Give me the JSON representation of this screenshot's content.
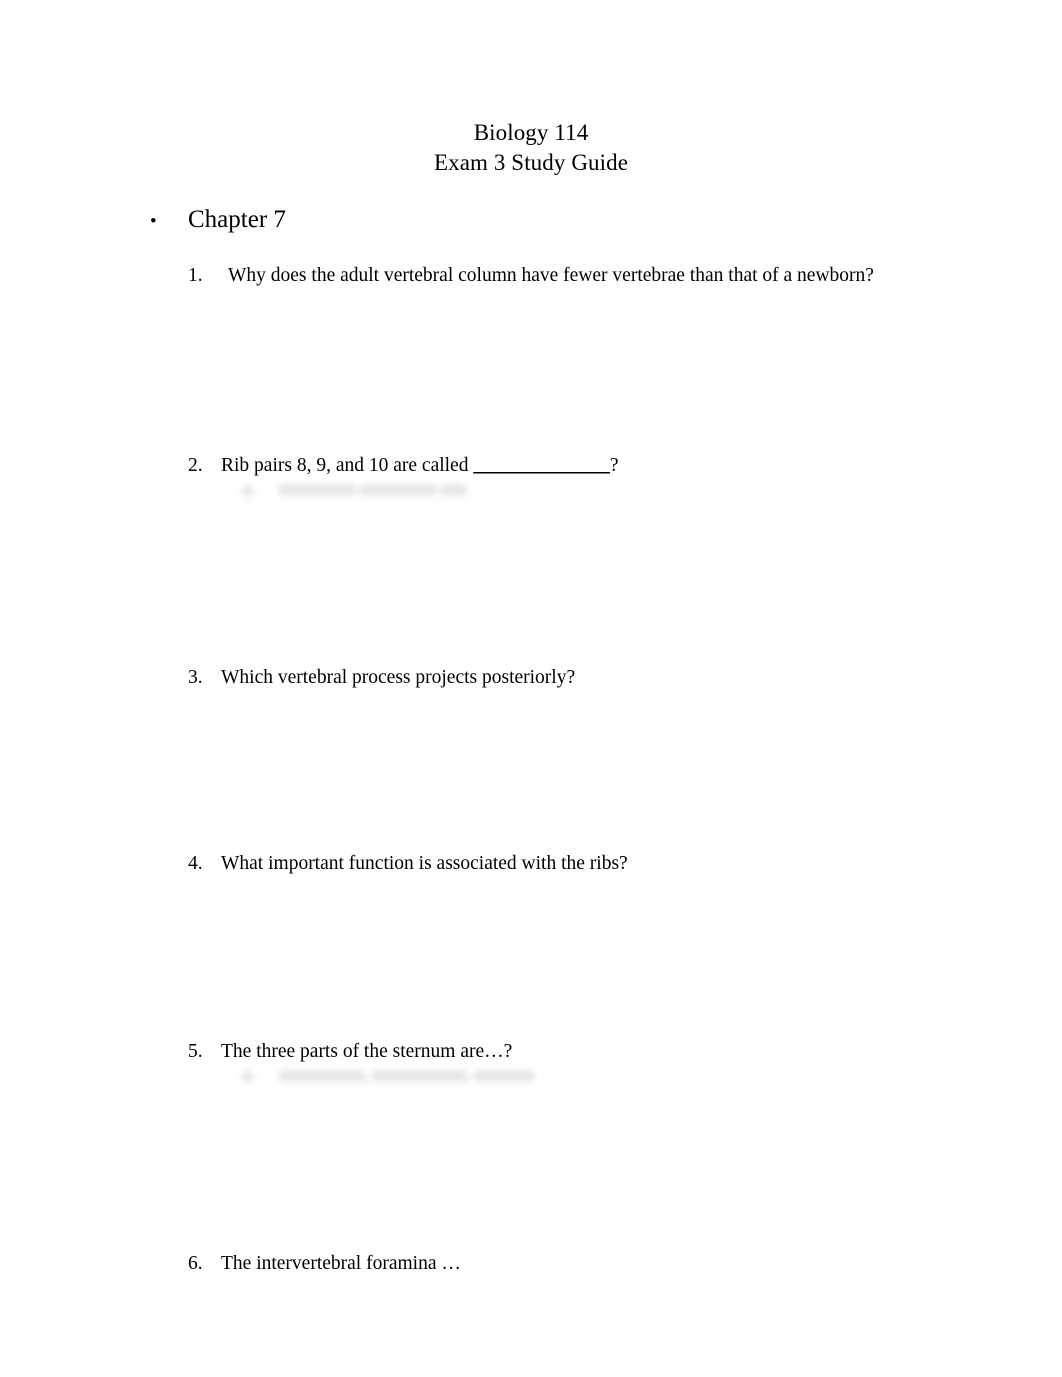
{
  "document": {
    "title_lines": [
      "Biology 114",
      "Exam 3 Study Guide"
    ],
    "title_line_1": "Biology 114",
    "title_line_2": "Exam 3 Study Guide"
  },
  "chapter": {
    "bullet_glyph": "•",
    "label": "Chapter 7"
  },
  "questions": [
    {
      "number": "1.",
      "text": "Why does the adult vertebral column have fewer vertebrae than that of a newborn?"
    },
    {
      "number": "2.",
      "text_before_blank": "Rib pairs 8, 9, and 10 are called ",
      "blank": "______________",
      "text_after_blank": "?",
      "full_text": "Rib pairs 8, 9, and 10 are called ______________?"
    },
    {
      "number": "3.",
      "text": "Which vertebral process projects posteriorly?"
    },
    {
      "number": "4.",
      "text": "What important function is associated with the ribs?"
    },
    {
      "number": "5.",
      "text": "The three parts of the sternum are…?"
    },
    {
      "number": "6.",
      "text": "The intervertebral foramina …"
    }
  ],
  "redacted_answers": [
    {
      "id": "above-q2",
      "marker": "",
      "text": "————————————————————————",
      "legibility": "illegible"
    },
    {
      "id": "below-q2",
      "marker": "a.",
      "text": "xxxxxxxxx xxxxxxxxx xxx",
      "legibility": "illegible"
    },
    {
      "id": "above-q5",
      "marker": "",
      "text": "————————————",
      "legibility": "illegible"
    },
    {
      "id": "below-q5",
      "marker": "a.",
      "text": "xxxxxxxxxx, xxxxxxxxxxx, xxxxxxx",
      "legibility": "illegible"
    }
  ]
}
